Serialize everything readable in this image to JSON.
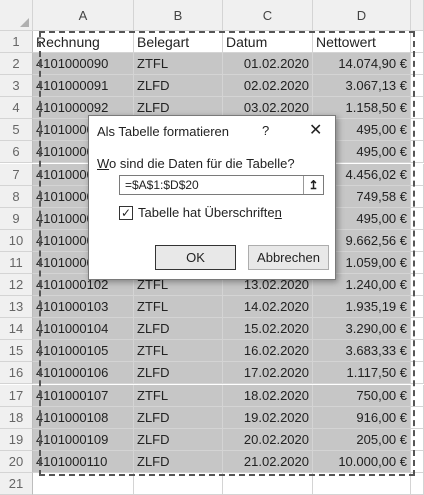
{
  "sheet": {
    "columns": [
      "A",
      "B",
      "C",
      "D"
    ],
    "row_numbers": [
      "1",
      "2",
      "3",
      "4",
      "5",
      "6",
      "7",
      "8",
      "9",
      "10",
      "11",
      "12",
      "13",
      "14",
      "15",
      "16",
      "17",
      "18",
      "19",
      "20",
      "21"
    ],
    "header": {
      "a": "Rechnung",
      "b": "Belegart",
      "c": "Datum",
      "d": "Nettowert"
    },
    "rows": [
      {
        "a": "4101000090",
        "b": "ZTFL",
        "c": "01.02.2020",
        "d": "14.074,90 €"
      },
      {
        "a": "4101000091",
        "b": "ZLFD",
        "c": "02.02.2020",
        "d": "3.067,13 €"
      },
      {
        "a": "4101000092",
        "b": "ZLFD",
        "c": "03.02.2020",
        "d": "1.158,50 €"
      },
      {
        "a": "4101000093",
        "b": "",
        "c": "",
        "d": "495,00 €"
      },
      {
        "a": "4101000094",
        "b": "",
        "c": "",
        "d": "495,00 €"
      },
      {
        "a": "4101000095",
        "b": "",
        "c": "",
        "d": "4.456,02 €"
      },
      {
        "a": "4101000096",
        "b": "",
        "c": "",
        "d": "749,58 €"
      },
      {
        "a": "4101000097",
        "b": "",
        "c": "",
        "d": "495,00 €"
      },
      {
        "a": "4101000098",
        "b": "",
        "c": "",
        "d": "9.662,56 €"
      },
      {
        "a": "4101000099",
        "b": "",
        "c": "",
        "d": "1.059,00 €"
      },
      {
        "a": "4101000102",
        "b": "ZTFL",
        "c": "13.02.2020",
        "d": "1.240,00 €"
      },
      {
        "a": "4101000103",
        "b": "ZTFL",
        "c": "14.02.2020",
        "d": "1.935,19 €"
      },
      {
        "a": "4101000104",
        "b": "ZLFD",
        "c": "15.02.2020",
        "d": "3.290,00 €"
      },
      {
        "a": "4101000105",
        "b": "ZTFL",
        "c": "16.02.2020",
        "d": "3.683,33 €"
      },
      {
        "a": "4101000106",
        "b": "ZLFD",
        "c": "17.02.2020",
        "d": "1.117,50 €"
      },
      {
        "a": "4101000107",
        "b": "ZTFL",
        "c": "18.02.2020",
        "d": "750,00 €"
      },
      {
        "a": "4101000108",
        "b": "ZLFD",
        "c": "19.02.2020",
        "d": "916,00 €"
      },
      {
        "a": "4101000109",
        "b": "ZLFD",
        "c": "20.02.2020",
        "d": "205,00 €"
      },
      {
        "a": "4101000110",
        "b": "ZLFD",
        "c": "21.02.2020",
        "d": "10.000,00 €"
      }
    ]
  },
  "dialog": {
    "title": "Als Tabelle formatieren",
    "help": "?",
    "close": "✕",
    "prompt_mnemonic": "W",
    "prompt_rest": "o sind die Daten für die Tabelle?",
    "range_value": "=$A$1:$D$20",
    "collapse_icon": "↥",
    "checkbox_mark": "✓",
    "checkbox_label_main": "Tabelle hat Überschrifte",
    "checkbox_label_mnemonic": "n",
    "ok_label": "OK",
    "cancel_label": "Abbrechen"
  },
  "colors": {
    "selection_fill": "#c6c6c6",
    "header_fill": "#f0f0f0"
  }
}
